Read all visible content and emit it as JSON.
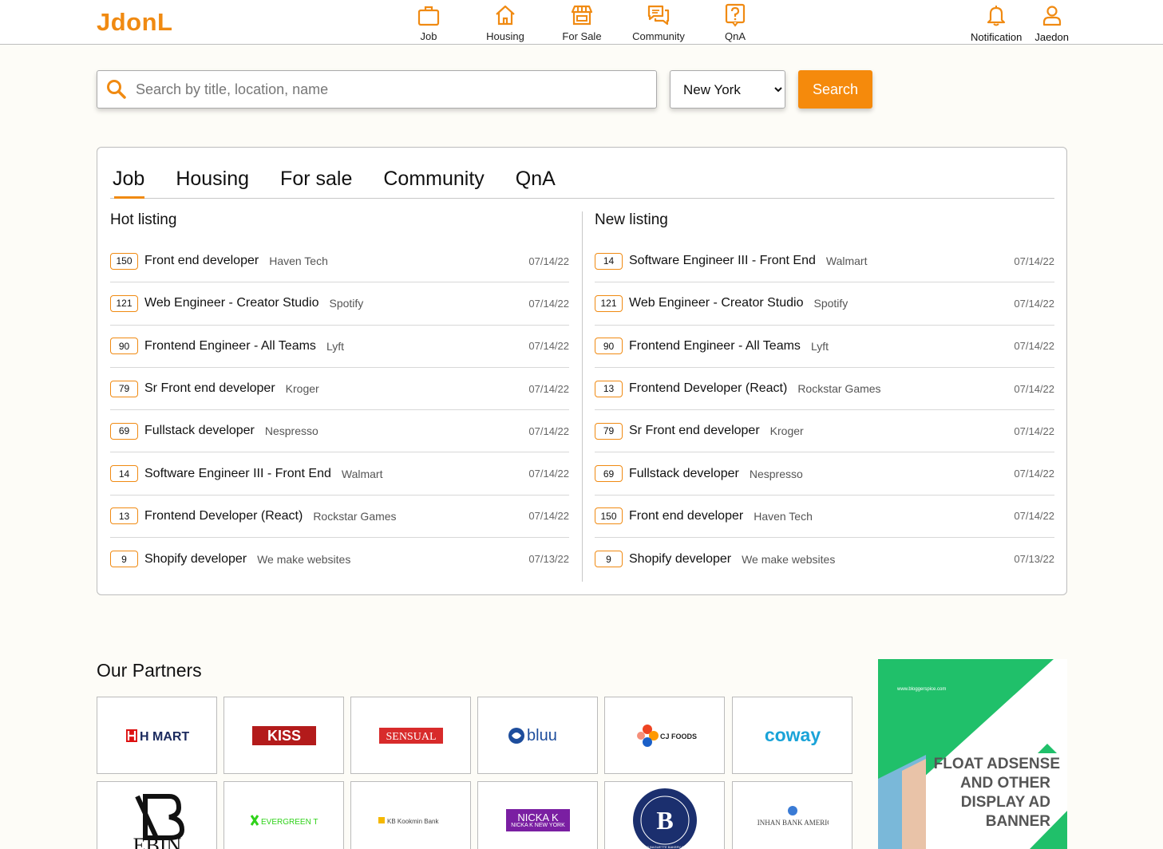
{
  "app": {
    "logo": "JdonL"
  },
  "nav": [
    {
      "label": "Job",
      "icon": "briefcase-icon"
    },
    {
      "label": "Housing",
      "icon": "house-icon"
    },
    {
      "label": "For Sale",
      "icon": "store-icon"
    },
    {
      "label": "Community",
      "icon": "chat-icon"
    },
    {
      "label": "QnA",
      "icon": "question-icon"
    }
  ],
  "user_nav": {
    "notification_label": "Notification",
    "user_label": "Jaedon"
  },
  "search": {
    "placeholder": "Search by title, location, name",
    "city": "New York",
    "button_label": "Search"
  },
  "tabs": [
    {
      "label": "Job",
      "active": true
    },
    {
      "label": "Housing",
      "active": false
    },
    {
      "label": "For sale",
      "active": false
    },
    {
      "label": "Community",
      "active": false
    },
    {
      "label": "QnA",
      "active": false
    }
  ],
  "hot_listing": {
    "heading": "Hot listing",
    "items": [
      {
        "count": "150",
        "title": "Front end developer",
        "company": "Haven Tech",
        "date": "07/14/22"
      },
      {
        "count": "121",
        "title": "Web Engineer - Creator Studio",
        "company": "Spotify",
        "date": "07/14/22"
      },
      {
        "count": "90",
        "title": "Frontend Engineer - All Teams",
        "company": "Lyft",
        "date": "07/14/22"
      },
      {
        "count": "79",
        "title": "Sr Front end developer",
        "company": "Kroger",
        "date": "07/14/22"
      },
      {
        "count": "69",
        "title": "Fullstack developer",
        "company": "Nespresso",
        "date": "07/14/22"
      },
      {
        "count": "14",
        "title": "Software Engineer III - Front End",
        "company": "Walmart",
        "date": "07/14/22"
      },
      {
        "count": "13",
        "title": "Frontend Developer (React)",
        "company": "Rockstar Games",
        "date": "07/14/22"
      },
      {
        "count": "9",
        "title": "Shopify developer",
        "company": "We make websites",
        "date": "07/13/22"
      }
    ]
  },
  "new_listing": {
    "heading": "New listing",
    "items": [
      {
        "count": "14",
        "title": "Software Engineer III - Front End",
        "company": "Walmart",
        "date": "07/14/22"
      },
      {
        "count": "121",
        "title": "Web Engineer - Creator Studio",
        "company": "Spotify",
        "date": "07/14/22"
      },
      {
        "count": "90",
        "title": "Frontend Engineer - All Teams",
        "company": "Lyft",
        "date": "07/14/22"
      },
      {
        "count": "13",
        "title": "Frontend Developer (React)",
        "company": "Rockstar Games",
        "date": "07/14/22"
      },
      {
        "count": "79",
        "title": "Sr Front end developer",
        "company": "Kroger",
        "date": "07/14/22"
      },
      {
        "count": "69",
        "title": "Fullstack developer",
        "company": "Nespresso",
        "date": "07/14/22"
      },
      {
        "count": "150",
        "title": "Front end developer",
        "company": "Haven Tech",
        "date": "07/14/22"
      },
      {
        "count": "9",
        "title": "Shopify developer",
        "company": "We make websites",
        "date": "07/13/22"
      }
    ]
  },
  "partners": {
    "heading": "Our Partners",
    "logos": [
      "H MART",
      "KISS",
      "SENSUAL",
      "bluu",
      "CJ FOODS",
      "coway",
      "EBIN",
      "EVERGREEN TEAM",
      "KB Kookmin Bank",
      "NICKA K NEW YORK",
      "PARIS BAGUETTE BAKERY CAFE",
      "SHINHAN BANK AMERICA"
    ]
  },
  "ad": {
    "url": "www.bloggerspice.com",
    "text": [
      "FLOAT ADSENSE",
      "AND OTHER",
      "DISPLAY AD",
      "BANNER"
    ]
  },
  "colors": {
    "accent": "#f08a12",
    "background": "#fdfcf7",
    "ad_green": "#20c06a"
  }
}
